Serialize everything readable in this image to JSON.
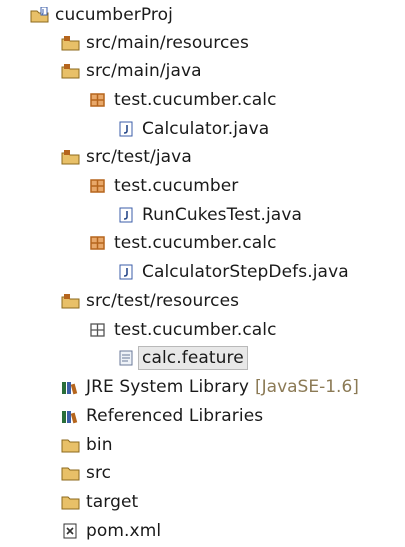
{
  "tree": {
    "root": {
      "label": "cucumberProj",
      "icon": "java-project-icon"
    },
    "items": [
      {
        "label": "src/main/resources",
        "icon": "source-folder-icon"
      },
      {
        "label": "src/main/java",
        "icon": "source-folder-icon"
      },
      {
        "label": "test.cucumber.calc",
        "icon": "package-icon"
      },
      {
        "label": "Calculator.java",
        "icon": "java-file-icon"
      },
      {
        "label": "src/test/java",
        "icon": "source-folder-icon"
      },
      {
        "label": "test.cucumber",
        "icon": "package-icon"
      },
      {
        "label": "RunCukesTest.java",
        "icon": "java-file-icon"
      },
      {
        "label": "test.cucumber.calc",
        "icon": "package-icon"
      },
      {
        "label": "CalculatorStepDefs.java",
        "icon": "java-file-icon"
      },
      {
        "label": "src/test/resources",
        "icon": "source-folder-icon"
      },
      {
        "label": "test.cucumber.calc",
        "icon": "resource-package-icon"
      },
      {
        "label": "calc.feature",
        "icon": "text-file-icon",
        "selected": true
      },
      {
        "label": "JRE System Library",
        "icon": "library-icon",
        "decoration": "[JavaSE-1.6]"
      },
      {
        "label": "Referenced Libraries",
        "icon": "library-icon"
      },
      {
        "label": "bin",
        "icon": "folder-icon"
      },
      {
        "label": "src",
        "icon": "folder-icon"
      },
      {
        "label": "target",
        "icon": "folder-icon"
      },
      {
        "label": "pom.xml",
        "icon": "xml-file-icon"
      }
    ]
  },
  "colors": {
    "folder": "#e8c068",
    "package": "#b5651d",
    "library": "#2a6e3a",
    "text": "#1a1a1a",
    "decoration": "#8b7a55"
  }
}
